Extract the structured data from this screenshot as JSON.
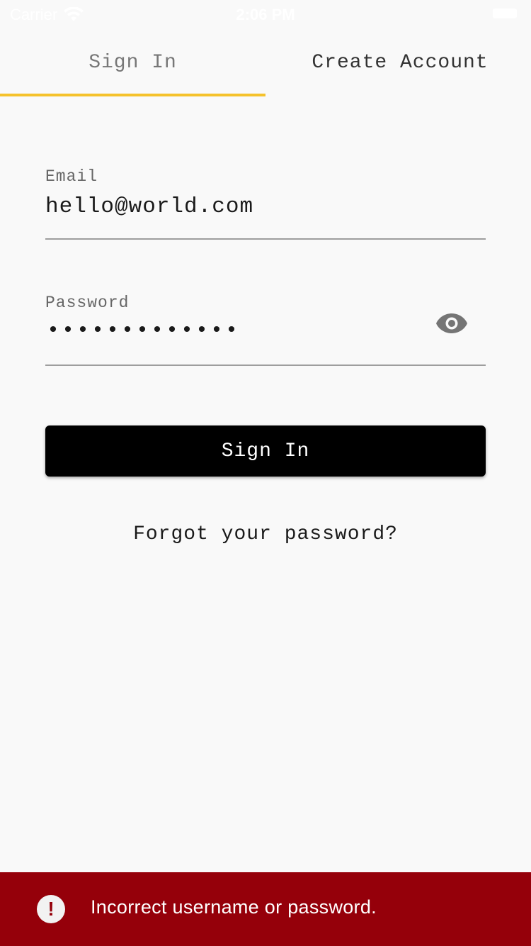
{
  "status_bar": {
    "carrier": "Carrier",
    "time": "2:06 PM",
    "wifi_icon": "wifi-icon",
    "battery_icon": "battery-icon"
  },
  "tabs": [
    {
      "label": "Sign In",
      "active": true
    },
    {
      "label": "Create Account",
      "active": false
    }
  ],
  "colors": {
    "accent": "#f5c22c",
    "background": "#f9f9f9",
    "button": "#000000",
    "error_banner": "#95000a"
  },
  "form": {
    "email": {
      "label": "Email",
      "value": "hello@world.com"
    },
    "password": {
      "label": "Password",
      "value": "•••••••••••••",
      "toggle_icon": "eye-icon"
    },
    "submit_label": "Sign In",
    "forgot_label": "Forgot your password?"
  },
  "error": {
    "icon": "alert-circle-icon",
    "message": "Incorrect username or password."
  }
}
